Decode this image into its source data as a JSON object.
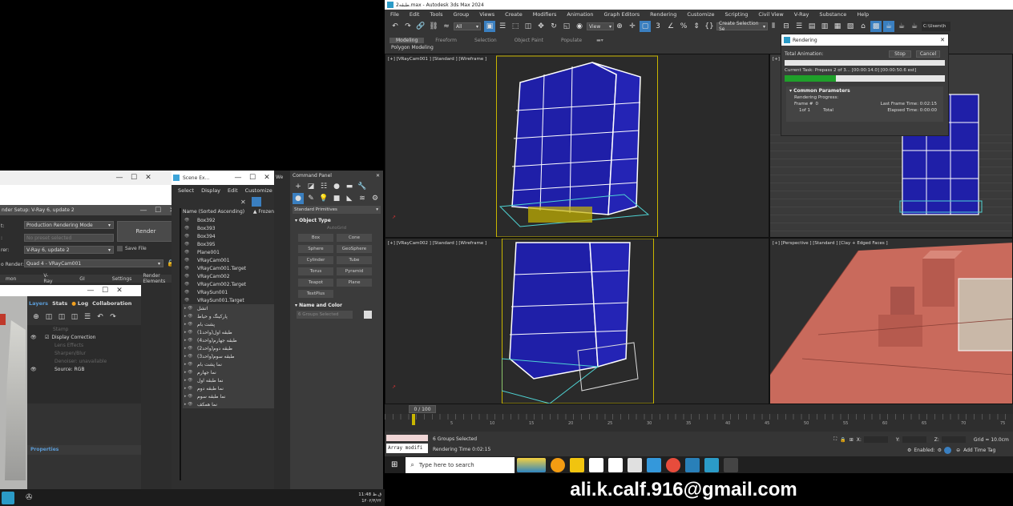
{
  "app": {
    "title": "2طبقه.max - Autodesk 3ds Max 2024",
    "menu": [
      "File",
      "Edit",
      "Tools",
      "Group",
      "Views",
      "Create",
      "Modifiers",
      "Animation",
      "Graph Editors",
      "Rendering",
      "Customize",
      "Scripting",
      "Civil View",
      "V-Ray",
      "Substance",
      "Help"
    ],
    "sel_filter": "All",
    "view_ref": "View",
    "create_sel_set": "Create Selection Se",
    "path": "C:\\Users\\h",
    "ribbon_tabs": [
      "Modeling",
      "Freeform",
      "Selection",
      "Object Paint",
      "Populate"
    ],
    "ribbon_sub": "Polygon Modeling"
  },
  "viewports": {
    "tl": "[+] [VRayCam001 ] [Standard ] [Wireframe ]",
    "bl": "[+] [VRayCam002 ] [Standard ] [Wireframe ]",
    "tr": "[+] [",
    "br": "[+] [Perspective ] [Standard ] [Clay + Edged Faces ]"
  },
  "rendering": {
    "title": "Rendering",
    "total_label": "Total Animation:",
    "stop": "Stop",
    "cancel": "Cancel",
    "current_task": "Current Task:  Prepass 2 of 3... [00:00:14.0] [00:00:50.6 est]",
    "task_progress": 0.32,
    "common": "Common Parameters",
    "progress_label": "Rendering Progress:",
    "frame_label": "Frame #",
    "frame_value": "0",
    "of_label": "1of 1",
    "total": "Total",
    "last_frame": "Last Frame Time:  0:02:15",
    "elapsed": "Elapsed Time:  0:00:00"
  },
  "render_setup": {
    "title": "nder Setup: V-Ray 6, update 2",
    "target_label": "t:",
    "target_value": "Production Rendering Mode",
    "preset_label": ":",
    "preset_value": "No preset selected",
    "renderer_label": "rer:",
    "renderer_value": "V-Ray 6, update 2",
    "save_file": "Save File",
    "view_label": "o Render:",
    "view_value": "Quad 4 - VRayCam001",
    "render_btn": "Render",
    "tabs": [
      "mon",
      "V-Ray",
      "GI",
      "Settings",
      "Render Elements"
    ]
  },
  "vfb": {
    "tabs": [
      "Layers",
      "Stats",
      "Log",
      "Collaboration"
    ],
    "layers": [
      "Stamp",
      "Display Correction",
      "Lens Effects",
      "Sharpen/Blur",
      "Denoiser: unavailable",
      "Source: RGB"
    ],
    "properties": "Properties"
  },
  "scene_explorer": {
    "title": "Scene Ex...",
    "menu": [
      "Select",
      "Display",
      "Edit",
      "Customize"
    ],
    "col_name": "Name (Sorted Ascending)",
    "col_frozen": "▲ Frozen",
    "rows": [
      "Box392",
      "Box393",
      "Box394",
      "Box395",
      "Plane001",
      "VRayCam001",
      "VRayCam001.Target",
      "VRayCam002",
      "VRayCam002.Target",
      "VRaySun001",
      "VRaySun001.Target",
      "اتشل",
      "پارکینگ و حیاط",
      "پشت بام",
      "طبقه اول(واحد1)",
      "طبقه جهارم(واحد4)",
      "طبقه دوم(واحد2)",
      "طبقه سوم(واحد3)",
      "نما پشت بام",
      "نما جهارم",
      "نما طبقه اول",
      "نما طبقه دوم",
      "نما طبقه سوم",
      "نما همکف"
    ]
  },
  "command_panel": {
    "title": "Command Panel",
    "dropdown": "Standard Primitives",
    "object_type": "Object Type",
    "autogrid": "AutoGrid",
    "buttons": [
      "Box",
      "Cone",
      "Sphere",
      "GeoSphere",
      "Cylinder",
      "Tube",
      "Torus",
      "Pyramid",
      "Teapot",
      "Plane",
      "TextPlus"
    ],
    "name_color": "Name and Color",
    "name_value": "6 Groups Selected",
    "we": "We"
  },
  "timeline": {
    "frame": "0 / 100",
    "ticks": [
      "5",
      "10",
      "15",
      "20",
      "25",
      "30",
      "35",
      "40",
      "45",
      "50",
      "55",
      "60",
      "65",
      "70",
      "75"
    ]
  },
  "status": {
    "script": "Array modifi",
    "selected": "6 Groups Selected",
    "render_time": "Rendering Time  0:02:15",
    "x": "X:",
    "y": "Y:",
    "z": "Z:",
    "grid": "Grid = 10.0cm",
    "enabled": "Enabled:",
    "addtag": "Add Time Tag"
  },
  "taskbar": {
    "search": "Type here to search",
    "time": "11:48 ق.ظ",
    "date": "1۴۰۲/۳/۲۴"
  },
  "overlay": {
    "email": "ali.k.calf.916@gmail.com"
  }
}
